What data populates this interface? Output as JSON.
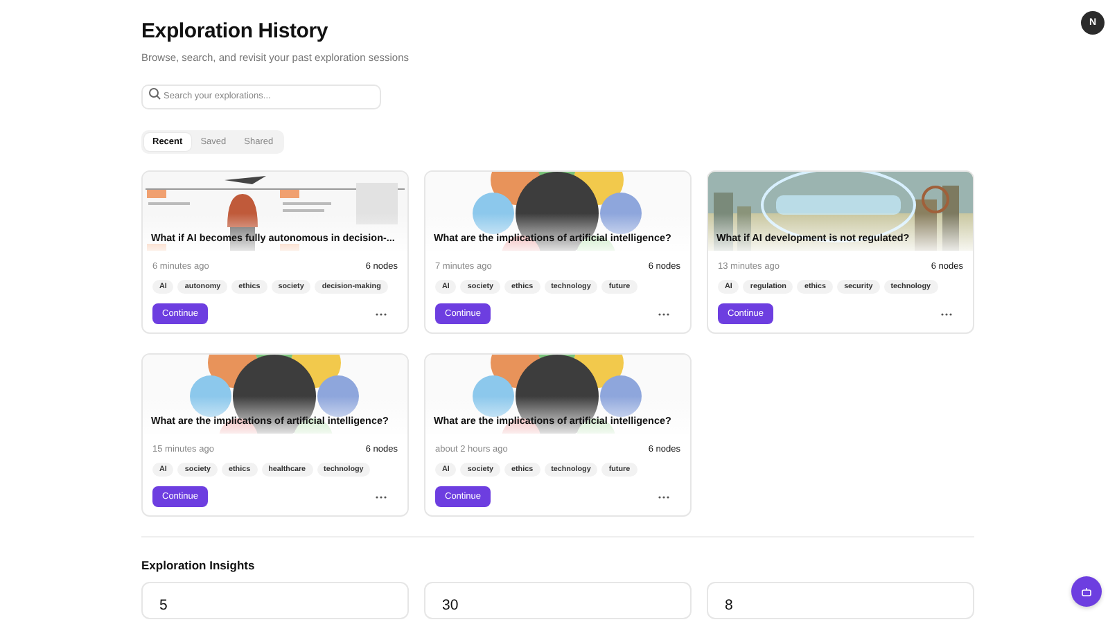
{
  "user": {
    "initial": "N"
  },
  "header": {
    "title": "Exploration History",
    "subtitle": "Browse, search, and revisit your past exploration sessions"
  },
  "search": {
    "placeholder": "Search your explorations..."
  },
  "tabs": [
    {
      "label": "Recent",
      "selected": true
    },
    {
      "label": "Saved",
      "selected": false
    },
    {
      "label": "Shared",
      "selected": false
    }
  ],
  "explorations": [
    {
      "title": "What if AI becomes fully autonomous in decision-...",
      "time": "6 minutes ago",
      "nodes": "6 nodes",
      "tags": [
        "AI",
        "autonomy",
        "ethics",
        "society",
        "decision-making"
      ],
      "action": "Continue"
    },
    {
      "title": "What are the implications of artificial intelligence?",
      "time": "7 minutes ago",
      "nodes": "6 nodes",
      "tags": [
        "AI",
        "society",
        "ethics",
        "technology",
        "future"
      ],
      "action": "Continue"
    },
    {
      "title": "What if AI development is not regulated?",
      "time": "13 minutes ago",
      "nodes": "6 nodes",
      "tags": [
        "AI",
        "regulation",
        "ethics",
        "security",
        "technology"
      ],
      "action": "Continue"
    },
    {
      "title": "What are the implications of artificial intelligence?",
      "time": "15 minutes ago",
      "nodes": "6 nodes",
      "tags": [
        "AI",
        "society",
        "ethics",
        "healthcare",
        "technology"
      ],
      "action": "Continue"
    },
    {
      "title": "What are the implications of artificial intelligence?",
      "time": "about 2 hours ago",
      "nodes": "6 nodes",
      "tags": [
        "AI",
        "society",
        "ethics",
        "technology",
        "future"
      ],
      "action": "Continue"
    }
  ],
  "insights": {
    "title": "Exploration Insights",
    "stats": [
      {
        "value": "5"
      },
      {
        "value": "30"
      },
      {
        "value": "8"
      }
    ]
  }
}
